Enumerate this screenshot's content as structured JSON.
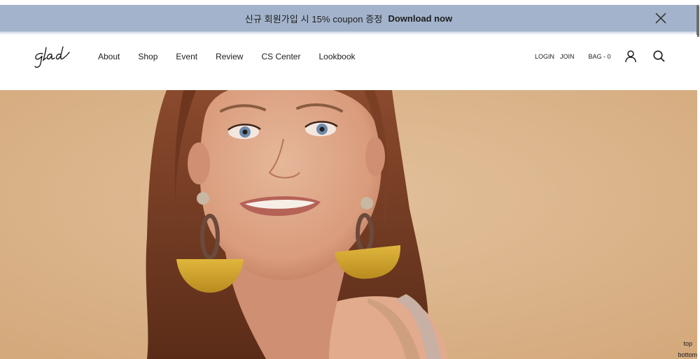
{
  "promo": {
    "text": "신규 회원가입 시 15% coupon 증정",
    "link_label": "Download now",
    "background_color": "#a3b3cb"
  },
  "header": {
    "logo_text": "glad",
    "nav": [
      {
        "label": "About"
      },
      {
        "label": "Shop"
      },
      {
        "label": "Event"
      },
      {
        "label": "Review"
      },
      {
        "label": "CS Center"
      },
      {
        "label": "Lookbook"
      }
    ],
    "util": {
      "login_label": "LOGIN",
      "join_label": "JOIN",
      "bag_label": "BAG - 0"
    },
    "icons": [
      "user-icon",
      "search-icon"
    ]
  },
  "hero": {
    "image": "model-with-yellow-earrings-photo",
    "background_color": "#ddb88e"
  },
  "scroll_links": {
    "top_label": "top",
    "bottom_label": "bottom"
  }
}
